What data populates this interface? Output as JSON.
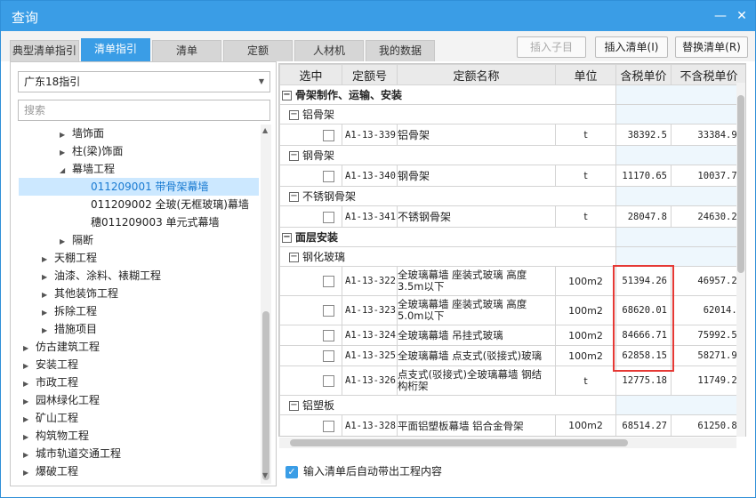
{
  "window": {
    "title": "查询",
    "min_icon": "minimize-icon",
    "close_icon": "close-icon"
  },
  "tabs": [
    "典型清单指引",
    "清单指引",
    "清单",
    "定额",
    "人材机",
    "我的数据"
  ],
  "toolbar": {
    "insert_child": "插入子目",
    "insert_list": "插入清单(I)",
    "replace_list": "替换清单(R)"
  },
  "left": {
    "select_value": "广东18指引",
    "search_placeholder": "搜索",
    "tree": [
      {
        "label": "墙饰面",
        "arrow": "▶"
      },
      {
        "label": "柱(梁)饰面",
        "arrow": "▶"
      },
      {
        "label": "幕墙工程",
        "arrow": "◢"
      },
      {
        "label": "011209001 带骨架幕墙",
        "arrow": ""
      },
      {
        "label": "011209002 全玻(无框玻璃)幕墙",
        "arrow": ""
      },
      {
        "label": "穗011209003 单元式幕墙",
        "arrow": ""
      },
      {
        "label": "隔断",
        "arrow": "▶"
      },
      {
        "label": "天棚工程",
        "arrow": "▶"
      },
      {
        "label": "油漆、涂料、裱糊工程",
        "arrow": "▶"
      },
      {
        "label": "其他装饰工程",
        "arrow": "▶"
      },
      {
        "label": "拆除工程",
        "arrow": "▶"
      },
      {
        "label": "措施项目",
        "arrow": "▶"
      },
      {
        "label": "仿古建筑工程",
        "arrow": "▶"
      },
      {
        "label": "安装工程",
        "arrow": "▶"
      },
      {
        "label": "市政工程",
        "arrow": "▶"
      },
      {
        "label": "园林绿化工程",
        "arrow": "▶"
      },
      {
        "label": "矿山工程",
        "arrow": "▶"
      },
      {
        "label": "构筑物工程",
        "arrow": "▶"
      },
      {
        "label": "城市轨道交通工程",
        "arrow": "▶"
      },
      {
        "label": "爆破工程",
        "arrow": "▶"
      }
    ]
  },
  "grid": {
    "headers": [
      "选中",
      "定额号",
      "定额名称",
      "单位",
      "含税单价",
      "不含税单价"
    ],
    "group1": "骨架制作、运输、安装",
    "sub_aluminum": "铝骨架",
    "r1": {
      "code": "A1-13-339",
      "name": "铝骨架",
      "unit": "t",
      "tax": "38392.5",
      "notax": "33384.99"
    },
    "sub_steel": "钢骨架",
    "r2": {
      "code": "A1-13-340",
      "name": "钢骨架",
      "unit": "t",
      "tax": "11170.65",
      "notax": "10037.78"
    },
    "sub_stainless": "不锈钢骨架",
    "r3": {
      "code": "A1-13-341",
      "name": "不锈钢骨架",
      "unit": "t",
      "tax": "28047.8",
      "notax": "24630.24"
    },
    "group2": "面层安装",
    "sub_glass": "钢化玻璃",
    "r4": {
      "code": "A1-13-322",
      "name1": "全玻璃幕墙 座装式玻璃 高度",
      "name2": "3.5m以下",
      "unit": "100m2",
      "tax": "51394.26",
      "notax": "46957.24"
    },
    "r5": {
      "code": "A1-13-323",
      "name1": "全玻璃幕墙 座装式玻璃 高度",
      "name2": "5.0m以下",
      "unit": "100m2",
      "tax": "68620.01",
      "notax": "62014.6"
    },
    "r6": {
      "code": "A1-13-324",
      "name": "全玻璃幕墙 吊挂式玻璃",
      "unit": "100m2",
      "tax": "84666.71",
      "notax": "75992.52"
    },
    "r7": {
      "code": "A1-13-325",
      "name": "全玻璃幕墙 点支式(驳接式)玻璃",
      "unit": "100m2",
      "tax": "62858.15",
      "notax": "58271.91"
    },
    "r8": {
      "code": "A1-13-326",
      "name1": "点支式(驳接式)全玻璃幕墙 钢结",
      "name2": "构桁架",
      "unit": "t",
      "tax": "12775.18",
      "notax": "11749.27"
    },
    "sub_alplastic": "铝塑板",
    "r9": {
      "code": "A1-13-328",
      "name": "平面铝塑板幕墙 铝合金骨架",
      "unit": "100m2",
      "tax": "68514.27",
      "notax": "61250.81"
    }
  },
  "footer": {
    "label": "输入清单后自动带出工程内容"
  },
  "colors": {
    "accent": "#3a9de6",
    "highlight": "#e53935"
  }
}
